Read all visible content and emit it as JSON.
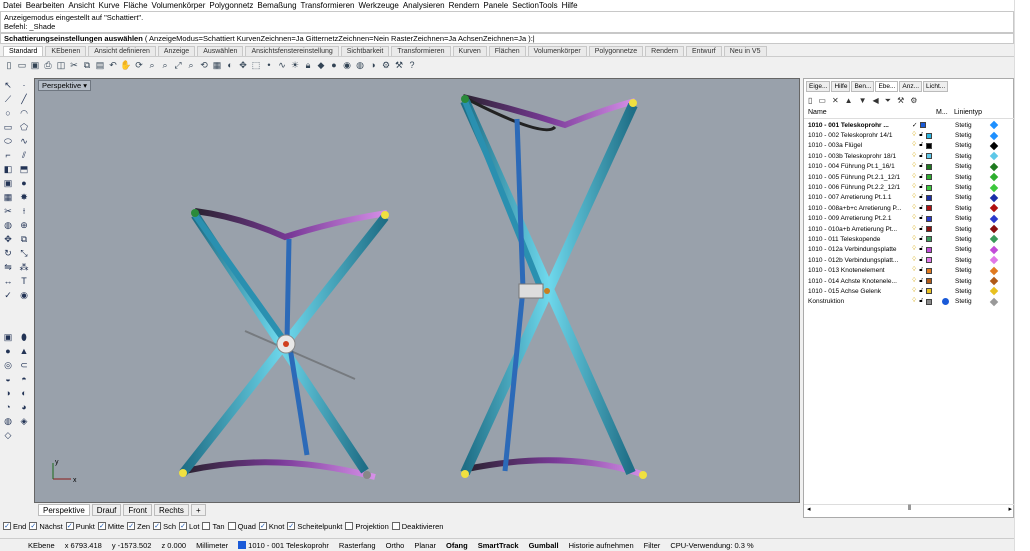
{
  "menu": [
    "Datei",
    "Bearbeiten",
    "Ansicht",
    "Kurve",
    "Fläche",
    "Volumenkörper",
    "Polygonnetz",
    "Bemaßung",
    "Transformieren",
    "Werkzeuge",
    "Analysieren",
    "Rendern",
    "Panele",
    "SectionTools",
    "Hilfe"
  ],
  "command": {
    "history_1": "Anzeigemodus eingestellt auf \"Schattiert\".",
    "history_2": "Befehl: _Shade",
    "prompt_bold": "Schattierungseinstellungen auswählen",
    "prompt_rest": " ( AnzeigeModus=Schattiert  KurvenZeichnen=Ja  GitternetzZeichnen=Nein  RasterZeichnen=Ja  AchsenZeichnen=Ja ):"
  },
  "toolbar_tabs": [
    "Standard",
    "KEbenen",
    "Ansicht definieren",
    "Anzeige",
    "Auswählen",
    "Ansichtsfenstereinstellung",
    "Sichtbarkeit",
    "Transformieren",
    "Kurven",
    "Flächen",
    "Volumenkörper",
    "Polygonnetze",
    "Rendern",
    "Entwurf",
    "Neu in V5"
  ],
  "viewport": {
    "title": "Perspektive",
    "tabs": [
      "Perspektive",
      "Drauf",
      "Front",
      "Rechts"
    ],
    "add_tab": "+",
    "axis_x": "x",
    "axis_y": "y",
    "background": "#99a1ab"
  },
  "osnaps": [
    {
      "label": "End",
      "checked": true
    },
    {
      "label": "Nächst",
      "checked": true
    },
    {
      "label": "Punkt",
      "checked": true
    },
    {
      "label": "Mitte",
      "checked": true
    },
    {
      "label": "Zen",
      "checked": true
    },
    {
      "label": "Sch",
      "checked": true
    },
    {
      "label": "Lot",
      "checked": true
    },
    {
      "label": "Tan",
      "checked": false
    },
    {
      "label": "Quad",
      "checked": false
    },
    {
      "label": "Knot",
      "checked": true
    },
    {
      "label": "Scheitelpunkt",
      "checked": true
    },
    {
      "label": "Projektion",
      "checked": false
    },
    {
      "label": "Deaktivieren",
      "checked": false
    }
  ],
  "status": {
    "layer_label": "KEbene",
    "x": "x 6793.418",
    "y": "y -1573.502",
    "z": "z 0.000",
    "units": "Millimeter",
    "current_layer": "1010 - 001 Teleskoprohr",
    "toggles": [
      "Rasterfang",
      "Ortho",
      "Planar",
      "Ofang",
      "SmartTrack",
      "Gumball",
      "Historie aufnehmen",
      "Filter"
    ],
    "bold_toggles": [
      "Ofang",
      "SmartTrack",
      "Gumball"
    ],
    "cpu": "CPU-Verwendung: 0.3 %"
  },
  "panel": {
    "tabs": [
      "Eige...",
      "Hilfe",
      "Ben...",
      "Ebe...",
      "Anz...",
      "Licht..."
    ],
    "active_tab": "Ebe...",
    "col_name": "Name",
    "col_material": "M...",
    "col_linetype": "Linientyp",
    "layers": [
      {
        "name": "1010 - 001 Teleskoprohr ...",
        "color": "#1a5ad8",
        "linetype": "Stetig",
        "current": true,
        "diamond": "#1e90ff"
      },
      {
        "name": "1010 - 002 Teleskoprohr 14/1",
        "color": "#2bb6e0",
        "linetype": "Stetig",
        "diamond": "#1e90ff"
      },
      {
        "name": "1010 - 003a Flügel",
        "color": "#000000",
        "linetype": "Stetig",
        "diamond": "#000000"
      },
      {
        "name": "1010 - 003b Teleskoprohr 18/1",
        "color": "#5ec8e8",
        "linetype": "Stetig",
        "diamond": "#5ec8e8"
      },
      {
        "name": "1010 - 004 Führung Pt.1_16/1",
        "color": "#1f7a1f",
        "linetype": "Stetig",
        "diamond": "#1f7a1f"
      },
      {
        "name": "1010 - 005 Führung Pt.2.1_12/1",
        "color": "#2eae2e",
        "linetype": "Stetig",
        "diamond": "#2eae2e"
      },
      {
        "name": "1010 - 006 Führung Pt.2.2_12/1",
        "color": "#3cc83c",
        "linetype": "Stetig",
        "diamond": "#3cc83c"
      },
      {
        "name": "1010 - 007 Arretierung Pt.1.1",
        "color": "#1b2fa8",
        "linetype": "Stetig",
        "diamond": "#1b2fa8"
      },
      {
        "name": "1010 - 008a+b+c Arretierung P...",
        "color": "#b01010",
        "linetype": "Stetig",
        "diamond": "#b01010"
      },
      {
        "name": "1010 - 009 Arretierung Pt.2.1",
        "color": "#2a3acc",
        "linetype": "Stetig",
        "diamond": "#2a3acc"
      },
      {
        "name": "1010 - 010a+b  Arretierung Pt...",
        "color": "#8a1010",
        "linetype": "Stetig",
        "diamond": "#8a1010"
      },
      {
        "name": "1010 - 011 Teleskopende",
        "color": "#3a9a5a",
        "linetype": "Stetig",
        "diamond": "#3a9a5a"
      },
      {
        "name": "1010 - 012a Verbindungsplatte",
        "color": "#c24bd8",
        "linetype": "Stetig",
        "diamond": "#c24bd8"
      },
      {
        "name": "1010 - 012b Verbindungsplatt...",
        "color": "#e078e8",
        "linetype": "Stetig",
        "diamond": "#e078e8"
      },
      {
        "name": "1010 - 013 Knotenelement",
        "color": "#e07a20",
        "linetype": "Stetig",
        "diamond": "#e07a20"
      },
      {
        "name": "1010 - 014 Achste Knotenele...",
        "color": "#b05a18",
        "linetype": "Stetig",
        "diamond": "#b05a18"
      },
      {
        "name": "1010 - 015 Achse Gelenk",
        "color": "#e8c020",
        "linetype": "Stetig",
        "diamond": "#e8c020"
      },
      {
        "name": "Konstruktion",
        "color": "#888888",
        "linetype": "Stetig",
        "diamond": "#999999",
        "material_dot": "#1a5ad8"
      }
    ]
  },
  "colors": {
    "accent": "#1a5ad8",
    "tube": "#3eb0c8",
    "plate": "#a04ac0"
  }
}
